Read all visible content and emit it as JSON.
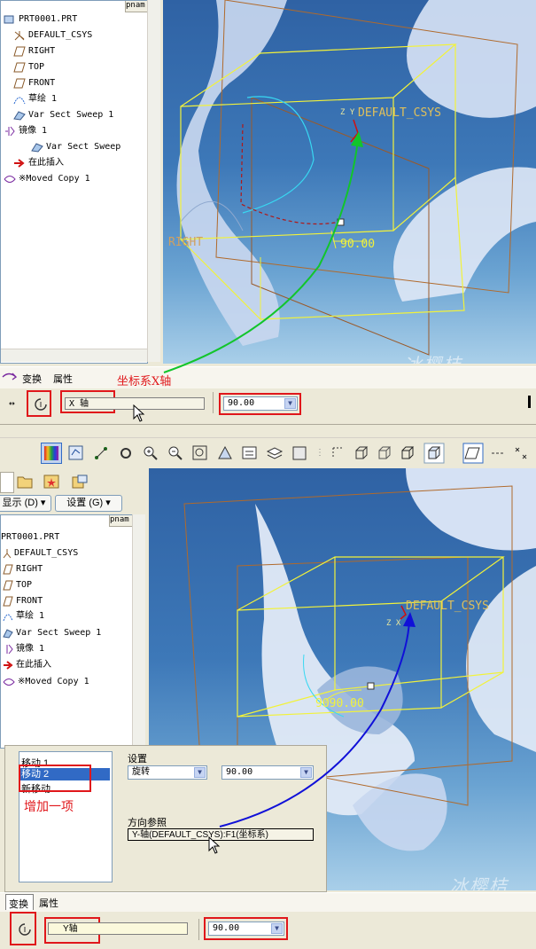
{
  "top": {
    "tree_header": "pnam",
    "tree": [
      {
        "label": "PRT0001.PRT",
        "icon": "part-icon"
      },
      {
        "label": "DEFAULT_CSYS",
        "icon": "csys-icon"
      },
      {
        "label": "RIGHT",
        "icon": "datum-plane-icon"
      },
      {
        "label": "TOP",
        "icon": "datum-plane-icon"
      },
      {
        "label": "FRONT",
        "icon": "datum-plane-icon"
      },
      {
        "label": "草绘 1",
        "icon": "sketch-icon"
      },
      {
        "label": "Var Sect Sweep 1",
        "icon": "sweep-icon"
      },
      {
        "label": "镜像 1",
        "icon": "mirror-icon"
      },
      {
        "label": "Var Sect Sweep",
        "icon": "sweep-icon"
      },
      {
        "label": "在此插入",
        "icon": "insert-here-arrow-icon"
      },
      {
        "label": "※Moved Copy 1",
        "icon": "moved-copy-icon"
      }
    ],
    "viewport": {
      "csys_label": "DEFAULT_CSYS",
      "csys_axes": "Z Y",
      "right_label": "RIGHT",
      "angle_label": "90.00"
    },
    "tabs": [
      "变换",
      "属性"
    ],
    "annotation": "坐标系X轴",
    "axis_field": "X 轴",
    "angle_value": "90.00",
    "watermark": "冰樱桔"
  },
  "bottom": {
    "sidebar_buttons": [
      "显示 (D) ▾",
      "设置 (G) ▾"
    ],
    "tree_header": "pnam",
    "tree": [
      {
        "label": "PRT0001.PRT",
        "icon": "part-icon"
      },
      {
        "label": "DEFAULT_CSYS",
        "icon": "csys-icon"
      },
      {
        "label": "RIGHT",
        "icon": "datum-plane-icon"
      },
      {
        "label": "TOP",
        "icon": "datum-plane-icon"
      },
      {
        "label": "FRONT",
        "icon": "datum-plane-icon"
      },
      {
        "label": "草绘 1",
        "icon": "sketch-icon"
      },
      {
        "label": "Var Sect Sweep 1",
        "icon": "sweep-icon"
      },
      {
        "label": "镜像 1",
        "icon": "mirror-icon"
      },
      {
        "label": "在此插入",
        "icon": "insert-here-arrow-icon"
      },
      {
        "label": "※Moved Copy 1",
        "icon": "moved-copy-icon"
      }
    ],
    "viewport": {
      "csys_label": "DEFAULT_CSYS",
      "csys_axes": "Z X",
      "angle_label": "9090.00"
    },
    "moves": [
      "移动 1",
      "移动 2",
      "新移动"
    ],
    "selected_move": "移动 2",
    "annotation": "增加一项",
    "settings_label": "设置",
    "settings_type": "旋转",
    "settings_angle": "90.00",
    "direction_ref_label": "方向参照",
    "direction_ref_value": "Y-轴(DEFAULT_CSYS):F1(坐标系)",
    "tabs": [
      "变换",
      "属性"
    ],
    "axis_field": "Y轴",
    "angle_value": "90.00",
    "watermark": "冰樱桔"
  },
  "colors": {
    "accent_red": "#e0171b",
    "green_arrow": "#12c52b",
    "blue_arrow": "#1010d8",
    "datum_yellow": "#ffff33",
    "datum_brown": "#8a5a2a"
  }
}
